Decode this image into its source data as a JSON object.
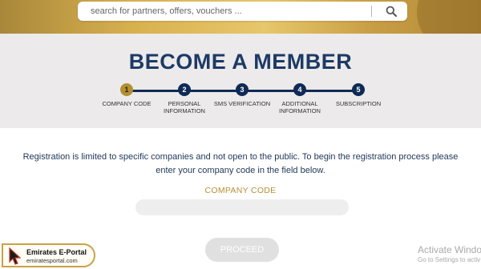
{
  "header": {
    "search_placeholder": "search for partners, offers, vouchers ...",
    "search_icon": "search-icon",
    "banner_color": "#d8b14f"
  },
  "page": {
    "title": "BECOME A MEMBER"
  },
  "steps": [
    {
      "number": "1",
      "label": "COMPANY CODE",
      "active": true
    },
    {
      "number": "2",
      "label": "PERSONAL INFORMATION",
      "active": false
    },
    {
      "number": "3",
      "label": "SMS VERIFICATION",
      "active": false
    },
    {
      "number": "4",
      "label": "ADDITIONAL INFORMATION",
      "active": false
    },
    {
      "number": "5",
      "label": "SUBSCRIPTION",
      "active": false
    }
  ],
  "form": {
    "intro": "Registration is limited to specific companies and not open to the public. To begin the registration process please enter your company code in the field below.",
    "field_label": "COMPANY CODE",
    "field_value": "",
    "proceed_label": "PROCEED"
  },
  "watermark": {
    "brand_name": "Emirates E-Portal",
    "brand_url": "emiratesportal.com",
    "activate_title": "Activate Window",
    "activate_sub": "Go to Settings to activ"
  },
  "colors": {
    "navy": "#0f2a55",
    "gold": "#b38f34",
    "title": "#1d3a66"
  }
}
